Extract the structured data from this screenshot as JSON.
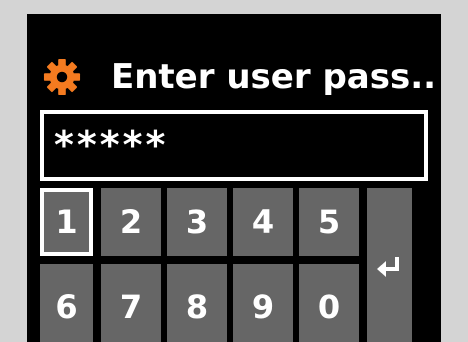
{
  "colors": {
    "background": "#d4d4d4",
    "screen": "#000000",
    "accent": "#f47b20",
    "key": "#666666",
    "text": "#ffffff"
  },
  "header": {
    "icon": "gear-icon",
    "title": "Enter user pass.."
  },
  "password_field": {
    "value": "*****"
  },
  "keypad": {
    "keys": [
      "1",
      "2",
      "3",
      "4",
      "5",
      "6",
      "7",
      "8",
      "9",
      "0"
    ],
    "selected": "1",
    "enter_icon": "enter-return-icon"
  }
}
